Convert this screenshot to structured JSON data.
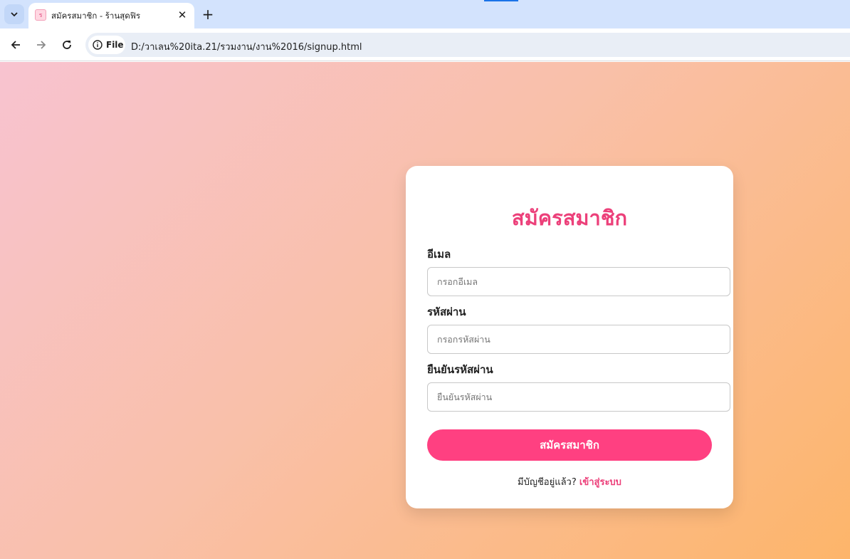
{
  "browser": {
    "tab_title": "สมัครสมาชิก - ร้านสุดฟิร",
    "favicon_glyph": "ร",
    "new_tab_glyph": "+",
    "close_glyph": "✕",
    "file_chip_label": "File",
    "url": "D:/วาเลน%20ita.21/รวมงาน/งาน%2016/signup.html",
    "accent_color": "#1a73e8"
  },
  "signup": {
    "title": "สมัครสมาชิก",
    "email_label": "อีเมล",
    "email_placeholder": "กรอกอีเมล",
    "password_label": "รหัสผ่าน",
    "password_placeholder": "กรอกรหัสผ่าน",
    "confirm_label": "ยืนยันรหัสผ่าน",
    "confirm_placeholder": "ยืนยันรหัสผ่าน",
    "submit_label": "สมัครสมาชิก",
    "have_account_text": "มีบัญชีอยู่แล้ว?",
    "login_link_label": "เข้าสู่ระบบ",
    "brand_color": "#ec407a",
    "button_color": "#ff4081"
  }
}
